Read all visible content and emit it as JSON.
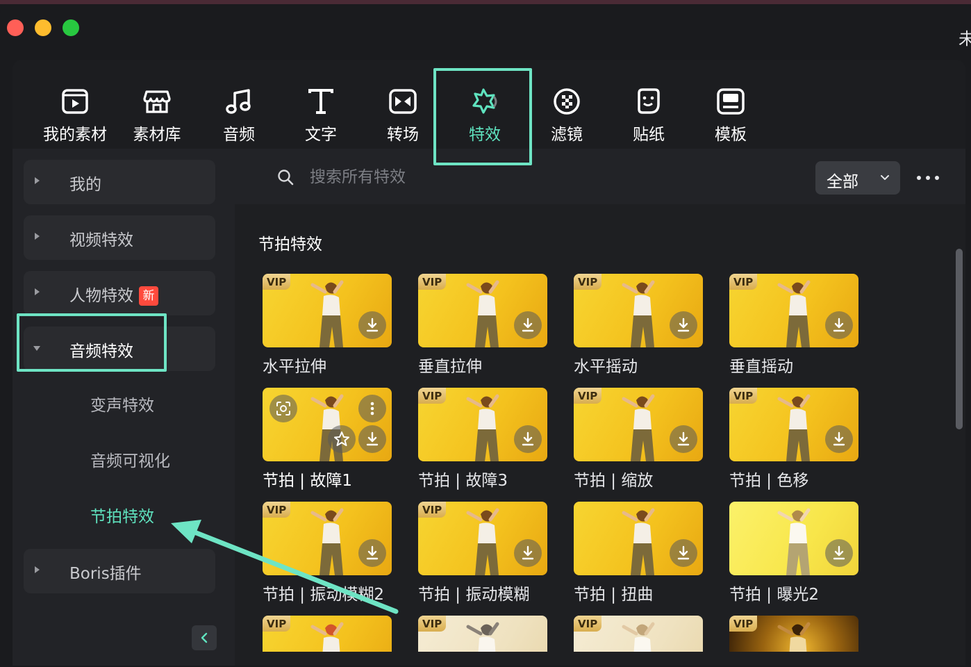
{
  "window": {
    "title_fragment": "未",
    "traffic_lights": [
      "#ff5f57",
      "#febc2e",
      "#28c840"
    ]
  },
  "tabs": [
    {
      "label": "我的素材",
      "icon": "media-icon"
    },
    {
      "label": "素材库",
      "icon": "store-icon"
    },
    {
      "label": "音频",
      "icon": "music-note-icon"
    },
    {
      "label": "文字",
      "icon": "text-t-icon"
    },
    {
      "label": "转场",
      "icon": "transition-icon"
    },
    {
      "label": "特效",
      "icon": "effects-star-icon",
      "active": true
    },
    {
      "label": "滤镜",
      "icon": "filter-icon"
    },
    {
      "label": "贴纸",
      "icon": "sticker-icon"
    },
    {
      "label": "模板",
      "icon": "template-icon"
    }
  ],
  "sidebar": {
    "items": [
      {
        "label": "我的"
      },
      {
        "label": "视频特效"
      },
      {
        "label": "人物特效",
        "badge": "新"
      },
      {
        "label": "音频特效",
        "expanded": true
      },
      {
        "label": "Boris插件"
      }
    ],
    "sub_items": [
      {
        "label": "变声特效"
      },
      {
        "label": "音频可视化"
      },
      {
        "label": "节拍特效",
        "active": true
      }
    ]
  },
  "search": {
    "placeholder": "搜索所有特效",
    "value": ""
  },
  "filter": {
    "value": "全部"
  },
  "section": {
    "title": "节拍特效"
  },
  "cards": [
    {
      "name": "水平拉伸",
      "vip": "VIP"
    },
    {
      "name": "垂直拉伸",
      "vip": "VIP"
    },
    {
      "name": "水平摇动",
      "vip": "VIP"
    },
    {
      "name": "垂直摇动",
      "vip": "VIP"
    },
    {
      "name": "节拍 | 故障1",
      "vip": ""
    },
    {
      "name": "节拍 | 故障3",
      "vip": "VIP"
    },
    {
      "name": "节拍 | 缩放",
      "vip": "VIP"
    },
    {
      "name": "节拍 | 色移",
      "vip": "VIP"
    },
    {
      "name": "节拍 | 振动模糊2",
      "vip": "VIP"
    },
    {
      "name": "节拍 | 振动模糊",
      "vip": "VIP"
    },
    {
      "name": "节拍 | 扭曲",
      "vip": ""
    },
    {
      "name": "节拍 | 曝光2",
      "vip": ""
    },
    {
      "name": "",
      "vip": "VIP"
    },
    {
      "name": "",
      "vip": "VIP"
    },
    {
      "name": "",
      "vip": "VIP"
    },
    {
      "name": "",
      "vip": "VIP"
    }
  ],
  "colors": {
    "accent": "#5fe3bf",
    "highlight": "#6ee4c4",
    "badge_new": "#ff4a3d"
  }
}
